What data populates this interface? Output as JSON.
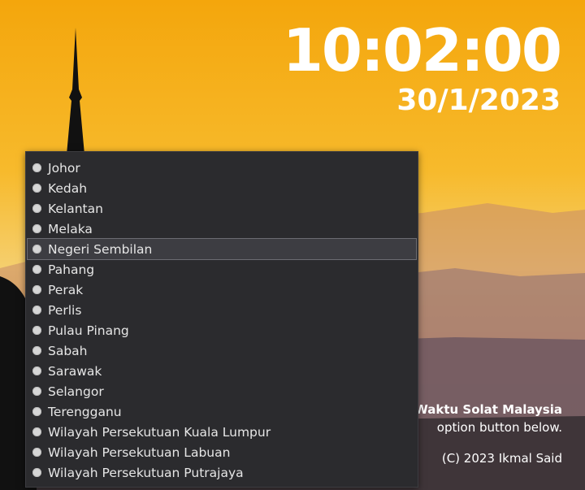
{
  "clock": {
    "time": "10:02:00",
    "date": "30/1/2023"
  },
  "info": {
    "title": "Waktu Solat Malaysia",
    "instruction": "option button below.",
    "copyright": "(C) 2023 Ikmal Said"
  },
  "states": [
    {
      "label": "Johor",
      "selected": false
    },
    {
      "label": "Kedah",
      "selected": false
    },
    {
      "label": "Kelantan",
      "selected": false
    },
    {
      "label": "Melaka",
      "selected": false
    },
    {
      "label": "Negeri Sembilan",
      "selected": true
    },
    {
      "label": "Pahang",
      "selected": false
    },
    {
      "label": "Perak",
      "selected": false
    },
    {
      "label": "Perlis",
      "selected": false
    },
    {
      "label": "Pulau Pinang",
      "selected": false
    },
    {
      "label": "Sabah",
      "selected": false
    },
    {
      "label": "Sarawak",
      "selected": false
    },
    {
      "label": "Selangor",
      "selected": false
    },
    {
      "label": "Terengganu",
      "selected": false
    },
    {
      "label": "Wilayah Persekutuan Kuala Lumpur",
      "selected": false
    },
    {
      "label": "Wilayah Persekutuan Labuan",
      "selected": false
    },
    {
      "label": "Wilayah Persekutuan Putrajaya",
      "selected": false
    }
  ],
  "colors": {
    "sky_top": "#f5a20f",
    "sky_mid": "#f7b730",
    "sky_horizon": "#f4d07a",
    "menu_bg": "#2b2b2e"
  }
}
